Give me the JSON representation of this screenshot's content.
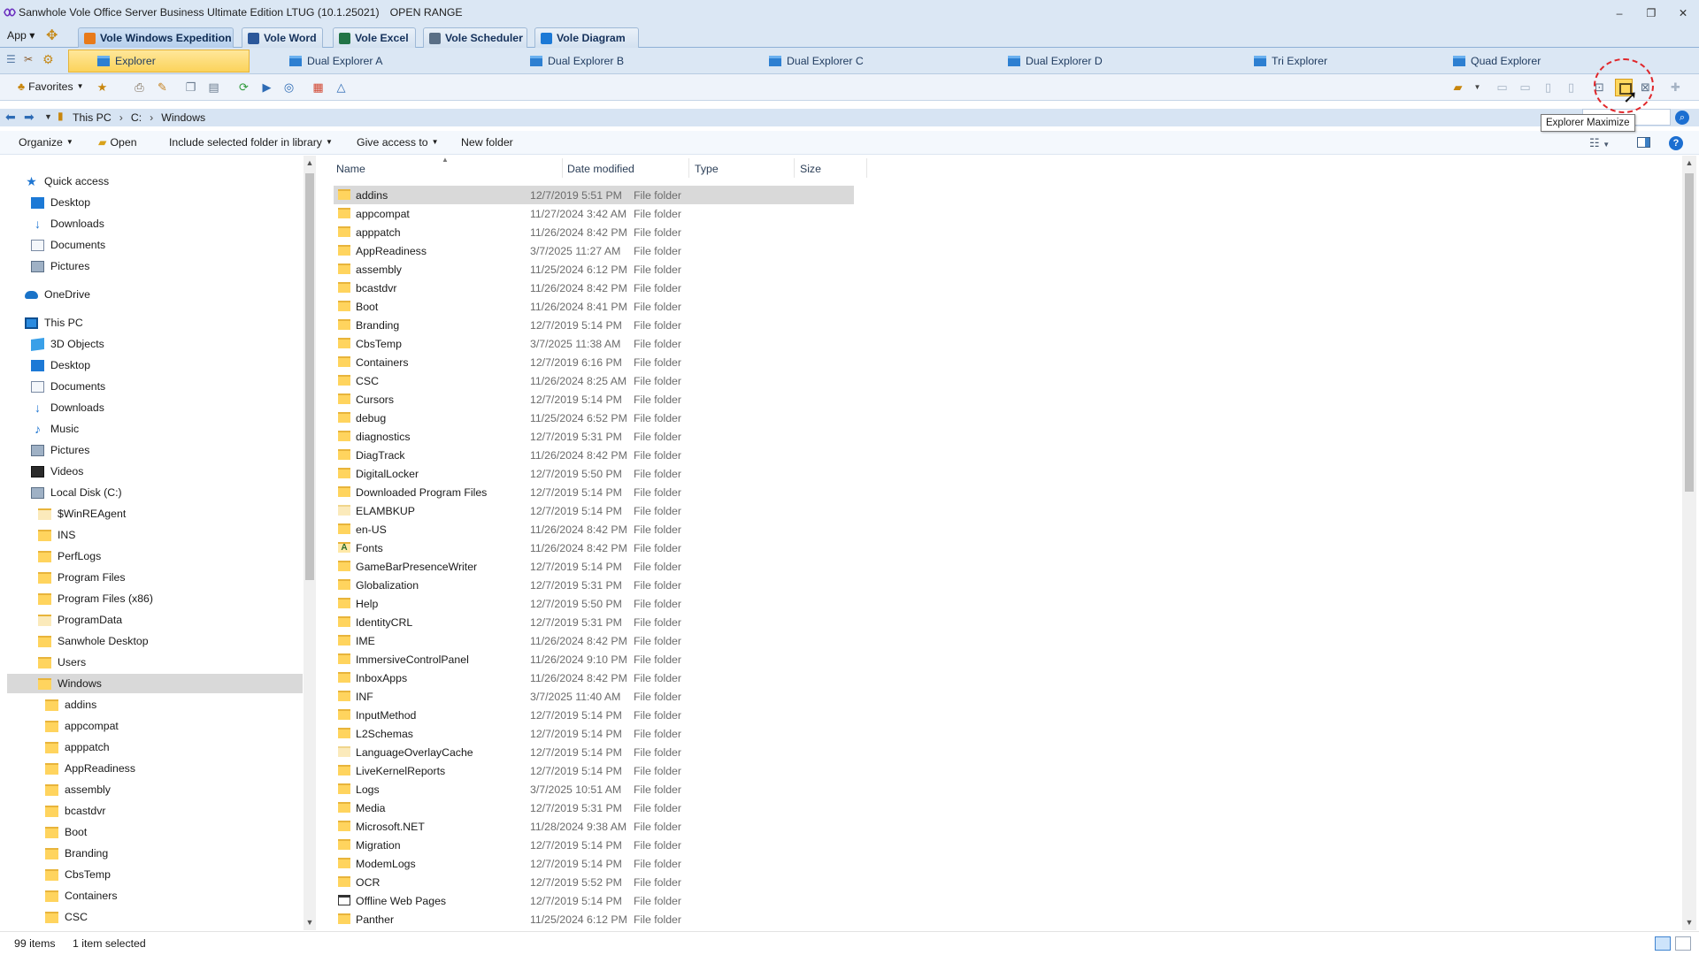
{
  "window": {
    "title": "Sanwhole Vole Office Server Business Ultimate Edition LTUG (10.1.25021)",
    "range_label": "OPEN RANGE",
    "minimize": "–",
    "restore": "❐",
    "close": "✕"
  },
  "suite": {
    "app_menu": "App ▾",
    "tabs": [
      {
        "label": "Vole Windows Expedition",
        "icon": "explorer-icon",
        "color": "#e87a1a"
      },
      {
        "label": "Vole Word",
        "icon": "word-icon",
        "color": "#2b579a"
      },
      {
        "label": "Vole Excel",
        "icon": "excel-icon",
        "color": "#217346"
      },
      {
        "label": "Vole Scheduler",
        "icon": "calendar-icon",
        "color": "#5a6f86"
      },
      {
        "label": "Vole Diagram",
        "icon": "diagram-icon",
        "color": "#1c79d6"
      }
    ]
  },
  "views": {
    "tabs": [
      "Explorer",
      "Dual Explorer A",
      "Dual Explorer B",
      "Dual Explorer C",
      "Dual Explorer D",
      "Tri Explorer",
      "Quad Explorer"
    ]
  },
  "toolbar": {
    "favorites_label": "Favorites",
    "tooltip": "Explorer Maximize"
  },
  "address": {
    "crumbs": [
      "This PC",
      "C:",
      "Windows"
    ]
  },
  "commands": {
    "organize": "Organize",
    "open": "Open",
    "include_library": "Include selected folder in library",
    "give_access": "Give access to",
    "new_folder": "New folder"
  },
  "nav": {
    "quick_access": "Quick access",
    "quick_items": [
      "Desktop",
      "Downloads",
      "Documents",
      "Pictures"
    ],
    "onedrive": "OneDrive",
    "this_pc": "This PC",
    "pc_items": [
      "3D Objects",
      "Desktop",
      "Documents",
      "Downloads",
      "Music",
      "Pictures",
      "Videos"
    ],
    "local_disk": "Local Disk (C:)",
    "disk_items": [
      "$WinREAgent",
      "INS",
      "PerfLogs",
      "Program Files",
      "Program Files (x86)",
      "ProgramData",
      "Sanwhole Desktop",
      "Users",
      "Windows"
    ],
    "windows_items": [
      "addins",
      "appcompat",
      "apppatch",
      "AppReadiness",
      "assembly",
      "bcastdvr",
      "Boot",
      "Branding",
      "CbsTemp",
      "Containers",
      "CSC"
    ]
  },
  "columns": {
    "name": "Name",
    "date": "Date modified",
    "type": "Type",
    "size": "Size"
  },
  "files": [
    {
      "name": "addins",
      "date": "12/7/2019 5:51 PM",
      "type": "File folder"
    },
    {
      "name": "appcompat",
      "date": "11/27/2024 3:42 AM",
      "type": "File folder"
    },
    {
      "name": "apppatch",
      "date": "11/26/2024 8:42 PM",
      "type": "File folder"
    },
    {
      "name": "AppReadiness",
      "date": "3/7/2025 11:27 AM",
      "type": "File folder"
    },
    {
      "name": "assembly",
      "date": "11/25/2024 6:12 PM",
      "type": "File folder"
    },
    {
      "name": "bcastdvr",
      "date": "11/26/2024 8:42 PM",
      "type": "File folder"
    },
    {
      "name": "Boot",
      "date": "11/26/2024 8:41 PM",
      "type": "File folder"
    },
    {
      "name": "Branding",
      "date": "12/7/2019 5:14 PM",
      "type": "File folder"
    },
    {
      "name": "CbsTemp",
      "date": "3/7/2025 11:38 AM",
      "type": "File folder"
    },
    {
      "name": "Containers",
      "date": "12/7/2019 6:16 PM",
      "type": "File folder"
    },
    {
      "name": "CSC",
      "date": "11/26/2024 8:25 AM",
      "type": "File folder"
    },
    {
      "name": "Cursors",
      "date": "12/7/2019 5:14 PM",
      "type": "File folder"
    },
    {
      "name": "debug",
      "date": "11/25/2024 6:52 PM",
      "type": "File folder"
    },
    {
      "name": "diagnostics",
      "date": "12/7/2019 5:31 PM",
      "type": "File folder"
    },
    {
      "name": "DiagTrack",
      "date": "11/26/2024 8:42 PM",
      "type": "File folder"
    },
    {
      "name": "DigitalLocker",
      "date": "12/7/2019 5:50 PM",
      "type": "File folder"
    },
    {
      "name": "Downloaded Program Files",
      "date": "12/7/2019 5:14 PM",
      "type": "File folder"
    },
    {
      "name": "ELAMBKUP",
      "date": "12/7/2019 5:14 PM",
      "type": "File folder"
    },
    {
      "name": "en-US",
      "date": "11/26/2024 8:42 PM",
      "type": "File folder"
    },
    {
      "name": "Fonts",
      "date": "11/26/2024 8:42 PM",
      "type": "File folder"
    },
    {
      "name": "GameBarPresenceWriter",
      "date": "12/7/2019 5:14 PM",
      "type": "File folder"
    },
    {
      "name": "Globalization",
      "date": "12/7/2019 5:31 PM",
      "type": "File folder"
    },
    {
      "name": "Help",
      "date": "12/7/2019 5:50 PM",
      "type": "File folder"
    },
    {
      "name": "IdentityCRL",
      "date": "12/7/2019 5:31 PM",
      "type": "File folder"
    },
    {
      "name": "IME",
      "date": "11/26/2024 8:42 PM",
      "type": "File folder"
    },
    {
      "name": "ImmersiveControlPanel",
      "date": "11/26/2024 9:10 PM",
      "type": "File folder"
    },
    {
      "name": "InboxApps",
      "date": "11/26/2024 8:42 PM",
      "type": "File folder"
    },
    {
      "name": "INF",
      "date": "3/7/2025 11:40 AM",
      "type": "File folder"
    },
    {
      "name": "InputMethod",
      "date": "12/7/2019 5:14 PM",
      "type": "File folder"
    },
    {
      "name": "L2Schemas",
      "date": "12/7/2019 5:14 PM",
      "type": "File folder"
    },
    {
      "name": "LanguageOverlayCache",
      "date": "12/7/2019 5:14 PM",
      "type": "File folder"
    },
    {
      "name": "LiveKernelReports",
      "date": "12/7/2019 5:14 PM",
      "type": "File folder"
    },
    {
      "name": "Logs",
      "date": "3/7/2025 10:51 AM",
      "type": "File folder"
    },
    {
      "name": "Media",
      "date": "12/7/2019 5:31 PM",
      "type": "File folder"
    },
    {
      "name": "Microsoft.NET",
      "date": "11/28/2024 9:38 AM",
      "type": "File folder"
    },
    {
      "name": "Migration",
      "date": "12/7/2019 5:14 PM",
      "type": "File folder"
    },
    {
      "name": "ModemLogs",
      "date": "12/7/2019 5:14 PM",
      "type": "File folder"
    },
    {
      "name": "OCR",
      "date": "12/7/2019 5:52 PM",
      "type": "File folder"
    },
    {
      "name": "Offline Web Pages",
      "date": "12/7/2019 5:14 PM",
      "type": "File folder"
    },
    {
      "name": "Panther",
      "date": "11/25/2024 6:12 PM",
      "type": "File folder"
    }
  ],
  "status": {
    "count": "99 items",
    "selected": "1 item selected"
  }
}
